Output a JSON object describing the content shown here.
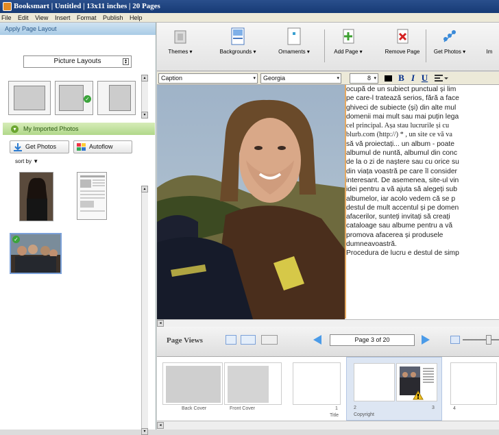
{
  "title": "Booksmart | Untitled | 13x11 inches | 20 Pages",
  "menu": [
    "File",
    "Edit",
    "View",
    "Insert",
    "Format",
    "Publish",
    "Help"
  ],
  "left_panel": {
    "layout_header": "Apply Page Layout",
    "layout_select": "Picture Layouts",
    "photos_header": "My Imported Photos",
    "get_photos": "Get Photos",
    "autoflow": "Autoflow",
    "sort_by": "sort by ▼"
  },
  "toolbar": {
    "themes": "Themes ▾",
    "backgrounds": "Backgrounds ▾",
    "ornaments": "Ornaments ▾",
    "add_page": "Add Page ▾",
    "remove_page": "Remove Page",
    "get_photos": "Get Photos ▾",
    "cut": "Im"
  },
  "format": {
    "style": "Caption",
    "font": "Georgia",
    "size": "8",
    "bold": "B",
    "italic": "I",
    "underline": "U"
  },
  "body_lines": [
    "ocupă de un subiect punctual și lim",
    "pe care-l tratează serios, fără a face",
    "ghiveci de subiecte (și) din alte mul",
    "domenii mai mult sau mai puțin lega",
    "cel principal. Așa stau lucrurile și cu",
    "blurb.com (http://) * , un site ce vă va",
    "să vă proiectați... un album - poate",
    "albumul de nuntă, albumul din conc",
    "de la o zi de naștere sau cu orice su",
    "din viața voastră pe care îl consider",
    "interesant. De asemenea, site-ul vin",
    "idei pentru a vă ajuta să alegeți sub",
    "albumelor, iar acolo vedem că se p",
    "destul de mult accentul și pe domen",
    "afacerilor, sunteți invitați să creați",
    "cataloage sau albume pentru a vă",
    "promova afacerea și produsele",
    "dumneavoastră.",
    "Procedura de lucru e destul de simp"
  ],
  "page_views": {
    "label": "Page Views",
    "page_field": "Page 3 of 20"
  },
  "strip": {
    "back_cover": "Back Cover",
    "front_cover": "Front Cover",
    "title_num": "1",
    "title_label": "Title",
    "copyright_num": "2",
    "copyright_label": "Copyright",
    "p3": "3",
    "p4": "4"
  }
}
